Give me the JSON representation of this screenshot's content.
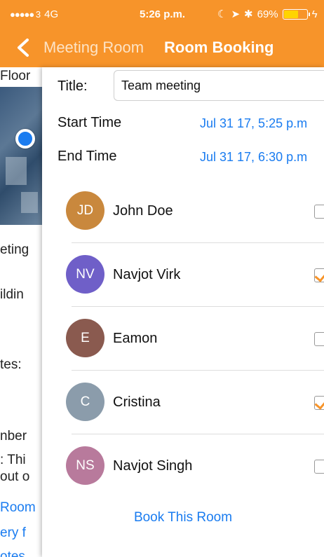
{
  "status_bar": {
    "signal": "●●●●● 3",
    "network": "4G",
    "time": "5:26 p.m.",
    "battery": "69%",
    "battery_level": 0.69
  },
  "nav": {
    "back_label": "Meeting Room",
    "title": "Room Booking"
  },
  "underlay": {
    "lines": [
      "Floor",
      "eting",
      "ildin",
      "tes:",
      "nber",
      ": Thi",
      "out o"
    ],
    "links": [
      "Room",
      "ery f",
      "otes"
    ]
  },
  "form": {
    "title_label": "Title:",
    "title_value": "Team meeting",
    "start_label": "Start Time",
    "start_value": "Jul 31 17, 5:25 p.m",
    "end_label": "End Time",
    "end_value": "Jul 31 17, 6:30 p.m"
  },
  "attendees": [
    {
      "initials": "JD",
      "name": "John Doe",
      "color": "#c9883d",
      "checked": false
    },
    {
      "initials": "NV",
      "name": "Navjot Virk",
      "color": "#6f5fc8",
      "checked": true
    },
    {
      "initials": "E",
      "name": "Eamon",
      "color": "#8a5a4f",
      "checked": false
    },
    {
      "initials": "C",
      "name": "Cristina",
      "color": "#8b9cab",
      "checked": true
    },
    {
      "initials": "NS",
      "name": "Navjot Singh",
      "color": "#b87a9c",
      "checked": false
    }
  ],
  "book_button": "Book This Room",
  "colors": {
    "accent": "#f7942a",
    "link": "#1a7cf0"
  }
}
